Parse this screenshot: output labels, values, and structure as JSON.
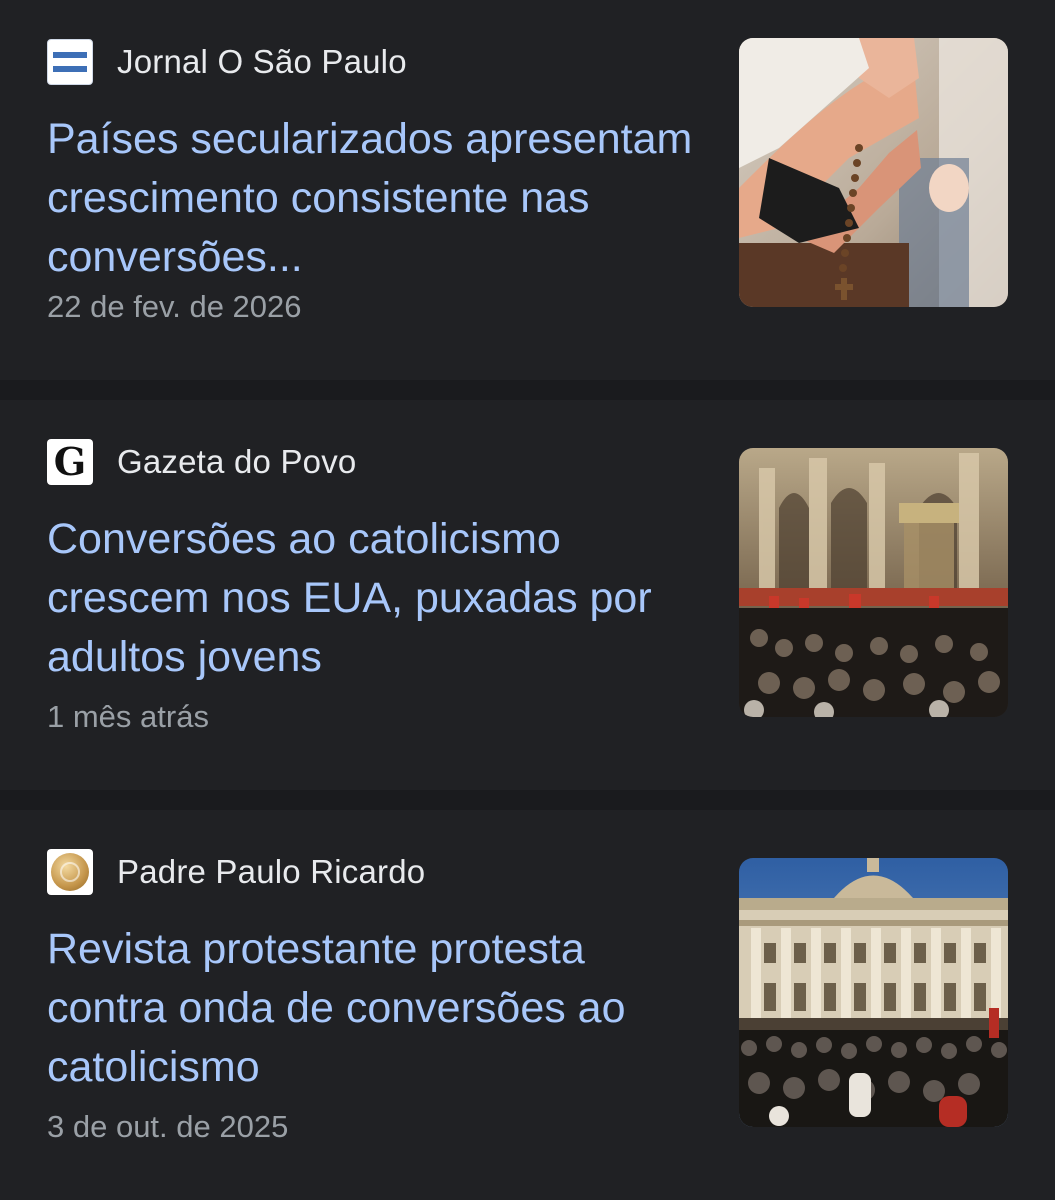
{
  "results": [
    {
      "source": "Jornal O São Paulo",
      "source_icon": "o-sao-paulo-logo-icon",
      "headline": "Países secularizados apresentam crescimento consistente nas conversões...",
      "timestamp": "22 de fev. de 2026",
      "thumbnail": "rosary-prayer-photo"
    },
    {
      "source": "Gazeta do Povo",
      "source_icon": "gazeta-do-povo-logo-icon",
      "source_icon_letter": "G",
      "headline": "Conversões ao catolicismo crescem nos EUA, puxadas por adultos jovens",
      "timestamp": "1 mês atrás",
      "thumbnail": "basilica-interior-mass-photo"
    },
    {
      "source": "Padre Paulo Ricardo",
      "source_icon": "padre-paulo-ricardo-logo-icon",
      "headline": "Revista protestante protesta contra onda de conversões ao catolicismo",
      "timestamp": "3 de out. de 2025",
      "thumbnail": "st-peters-basilica-crowd-photo"
    }
  ],
  "colors": {
    "background": "#1a1b1e",
    "card": "#202124",
    "headline": "#a8c7fa",
    "source": "#e8eaed",
    "timestamp": "#9aa0a6"
  }
}
